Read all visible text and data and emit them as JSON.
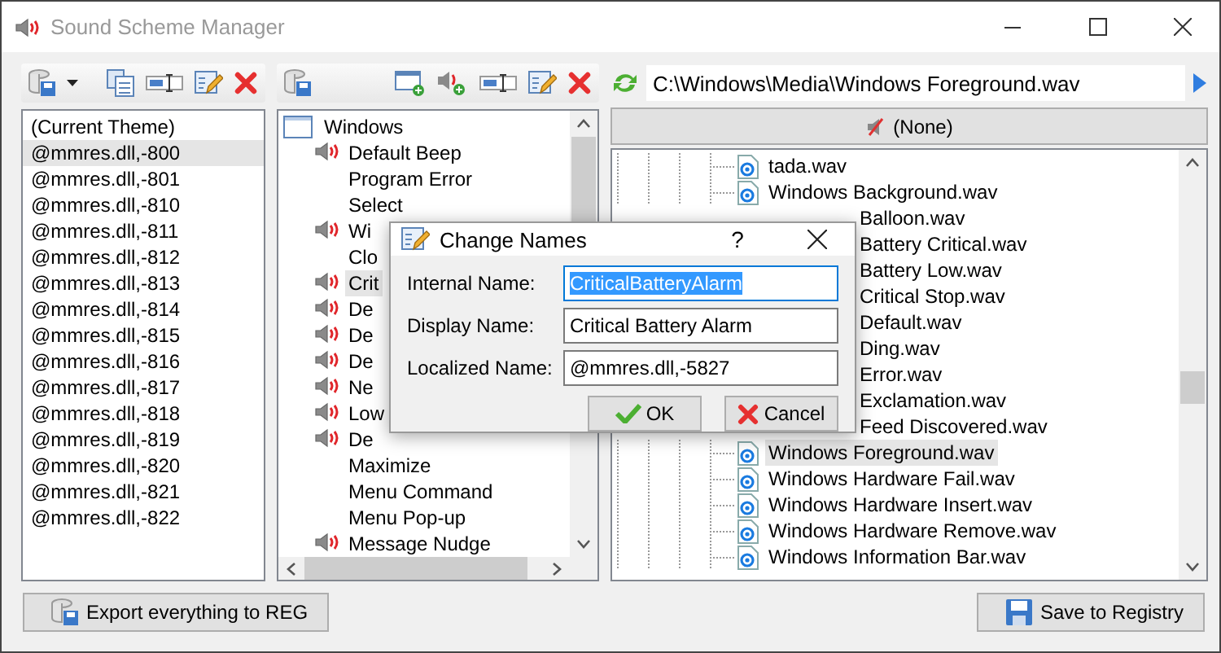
{
  "window": {
    "title": "Sound Scheme Manager"
  },
  "schemes": [
    {
      "label": "(Current Theme)",
      "selected": false
    },
    {
      "label": "@mmres.dll,-800",
      "selected": true
    },
    {
      "label": "@mmres.dll,-801",
      "selected": false
    },
    {
      "label": "@mmres.dll,-810",
      "selected": false
    },
    {
      "label": "@mmres.dll,-811",
      "selected": false
    },
    {
      "label": "@mmres.dll,-812",
      "selected": false
    },
    {
      "label": "@mmres.dll,-813",
      "selected": false
    },
    {
      "label": "@mmres.dll,-814",
      "selected": false
    },
    {
      "label": "@mmres.dll,-815",
      "selected": false
    },
    {
      "label": "@mmres.dll,-816",
      "selected": false
    },
    {
      "label": "@mmres.dll,-817",
      "selected": false
    },
    {
      "label": "@mmres.dll,-818",
      "selected": false
    },
    {
      "label": "@mmres.dll,-819",
      "selected": false
    },
    {
      "label": "@mmres.dll,-820",
      "selected": false
    },
    {
      "label": "@mmres.dll,-821",
      "selected": false
    },
    {
      "label": "@mmres.dll,-822",
      "selected": false
    }
  ],
  "events": [
    {
      "label": "Windows",
      "children": [
        {
          "label": "Default Beep",
          "has_sound": true,
          "selected": false
        },
        {
          "label": "Program Error",
          "has_sound": false,
          "selected": false
        },
        {
          "label": "Select",
          "has_sound": false,
          "selected": false
        },
        {
          "label": "Wi",
          "has_sound": true,
          "selected": false
        },
        {
          "label": "Clo",
          "has_sound": false,
          "selected": false
        },
        {
          "label": "Crit",
          "has_sound": true,
          "selected": true
        },
        {
          "label": "De",
          "has_sound": true,
          "selected": false
        },
        {
          "label": "De",
          "has_sound": true,
          "selected": false
        },
        {
          "label": "De",
          "has_sound": true,
          "selected": false
        },
        {
          "label": "Ne",
          "has_sound": true,
          "selected": false
        },
        {
          "label": "Low",
          "has_sound": true,
          "selected": false
        },
        {
          "label": "De",
          "has_sound": true,
          "selected": false
        },
        {
          "label": "Maximize",
          "has_sound": false,
          "selected": false
        },
        {
          "label": "Menu Command",
          "has_sound": false,
          "selected": false
        },
        {
          "label": "Menu Pop-up",
          "has_sound": false,
          "selected": false
        },
        {
          "label": "Message Nudge",
          "has_sound": true,
          "selected": false
        }
      ]
    }
  ],
  "sound_path": {
    "value": "C:\\Windows\\Media\\Windows Foreground.wav"
  },
  "none_button": {
    "label": "(None)"
  },
  "files": [
    {
      "name": "tada.wav",
      "kind": "file",
      "selected": false
    },
    {
      "name": "Windows Background.wav",
      "kind": "file",
      "selected": false
    },
    {
      "name": "Balloon.wav",
      "kind": "fragment",
      "selected": false
    },
    {
      "name": "Battery Critical.wav",
      "kind": "fragment",
      "selected": false
    },
    {
      "name": "Battery Low.wav",
      "kind": "fragment",
      "selected": false
    },
    {
      "name": "Critical Stop.wav",
      "kind": "fragment",
      "selected": false
    },
    {
      "name": "Default.wav",
      "kind": "fragment",
      "selected": false
    },
    {
      "name": "Ding.wav",
      "kind": "fragment",
      "selected": false
    },
    {
      "name": "Error.wav",
      "kind": "fragment",
      "selected": false
    },
    {
      "name": "Exclamation.wav",
      "kind": "fragment",
      "selected": false
    },
    {
      "name": "Feed Discovered.wav",
      "kind": "fragment",
      "selected": false
    },
    {
      "name": "Windows Foreground.wav",
      "kind": "file",
      "selected": true
    },
    {
      "name": "Windows Hardware Fail.wav",
      "kind": "file",
      "selected": false
    },
    {
      "name": "Windows Hardware Insert.wav",
      "kind": "file",
      "selected": false
    },
    {
      "name": "Windows Hardware Remove.wav",
      "kind": "file",
      "selected": false
    },
    {
      "name": "Windows Information Bar.wav",
      "kind": "file",
      "selected": false
    }
  ],
  "dialog": {
    "title": "Change Names",
    "help": "?",
    "fields": [
      {
        "label": "Internal Name:",
        "value": "CriticalBatteryAlarm",
        "selected": true
      },
      {
        "label": "Display Name:",
        "value": "Critical Battery Alarm",
        "selected": false
      },
      {
        "label": "Localized Name:",
        "value": "@mmres.dll,-5827",
        "selected": false
      }
    ],
    "buttons": [
      {
        "label": "OK",
        "kind": "ok"
      },
      {
        "label": "Cancel",
        "kind": "cancel"
      }
    ]
  },
  "footer": {
    "export": "Export everything to REG",
    "save": "Save to Registry"
  }
}
